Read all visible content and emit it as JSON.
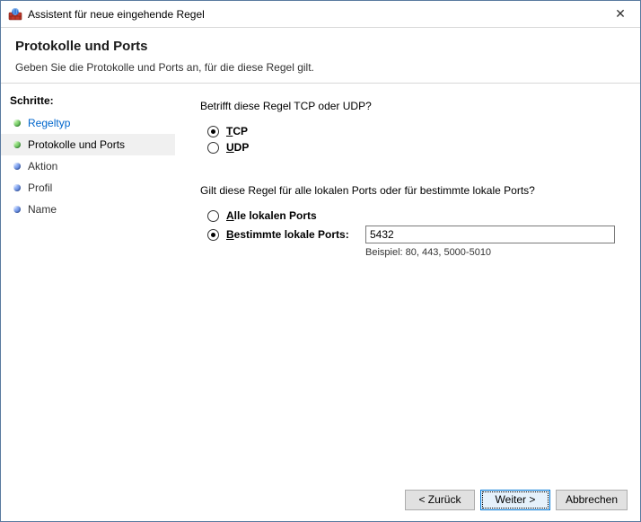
{
  "window": {
    "title": "Assistent für neue eingehende Regel",
    "close_glyph": "✕"
  },
  "header": {
    "title": "Protokolle und Ports",
    "subtitle": "Geben Sie die Protokolle und Ports an, für die diese Regel gilt."
  },
  "sidebar": {
    "title": "Schritte:",
    "steps": [
      {
        "label": "Regeltyp"
      },
      {
        "label": "Protokolle und Ports"
      },
      {
        "label": "Aktion"
      },
      {
        "label": "Profil"
      },
      {
        "label": "Name"
      }
    ]
  },
  "content": {
    "protocol_question": "Betrifft diese Regel TCP oder UDP?",
    "tcp": {
      "prefix": "T",
      "rest": "CP"
    },
    "udp": {
      "prefix": "U",
      "rest": "DP"
    },
    "ports_question": "Gilt diese Regel für alle lokalen Ports oder für bestimmte lokale Ports?",
    "all_ports": {
      "prefix": "A",
      "rest": "lle lokalen Ports"
    },
    "specific_ports": {
      "prefix": "B",
      "rest": "estimmte lokale Ports:"
    },
    "port_value": "5432",
    "example": "Beispiel: 80, 443, 5000-5010"
  },
  "footer": {
    "back": "< Zurück",
    "next": "Weiter >",
    "cancel": "Abbrechen"
  }
}
